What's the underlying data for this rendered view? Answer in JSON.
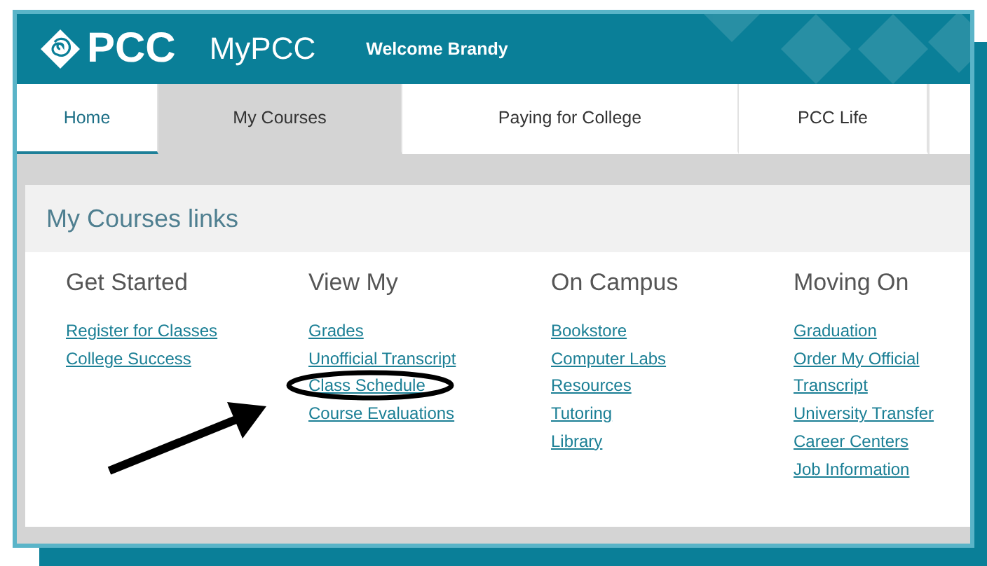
{
  "header": {
    "logo_text": "PCC",
    "site_title": "MyPCC",
    "welcome": "Welcome Brandy"
  },
  "tabs": [
    {
      "label": "Home",
      "selected": true,
      "active": false
    },
    {
      "label": "My Courses",
      "selected": false,
      "active": true
    },
    {
      "label": "Paying for College",
      "selected": false,
      "active": false
    },
    {
      "label": "PCC Life",
      "selected": false,
      "active": false
    }
  ],
  "panel": {
    "title": "My Courses links",
    "columns": [
      {
        "heading": "Get Started",
        "links": [
          "Register for Classes",
          "College Success"
        ]
      },
      {
        "heading": "View My",
        "links": [
          "Grades",
          "Unofficial Transcript",
          "Class Schedule",
          "Course Evaluations"
        ]
      },
      {
        "heading": "On Campus",
        "links": [
          "Bookstore",
          "Computer Labs",
          "Resources",
          "Tutoring",
          "Library"
        ]
      },
      {
        "heading": "Moving On",
        "links": [
          "Graduation",
          "Order My Official",
          "Transcript",
          "University Transfer",
          "Career Centers",
          "Job Information"
        ]
      }
    ]
  }
}
